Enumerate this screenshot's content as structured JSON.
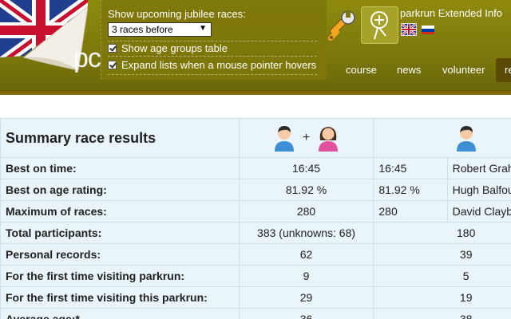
{
  "header": {
    "logo_fragment": "pc",
    "options": {
      "title": "Show upcoming jubilee races:",
      "select_value": "3 races before",
      "show_age_groups": "Show age groups table",
      "expand_lists": "Expand lists when a mouse pointer hovers"
    },
    "extension_title": "parkrun Extended Info",
    "nav": [
      "course",
      "news",
      "volunteer",
      "re"
    ]
  },
  "colors": {
    "header": "#7c780c",
    "nav_active": "#5a4a06",
    "row_alt": "#eaf4fb"
  },
  "icons": [
    "uk-flag-corner-icon",
    "wrench-icon",
    "tree-magnifier-icon",
    "uk-flag-icon",
    "russia-flag-icon",
    "male-female-icon",
    "male-icon"
  ],
  "table": {
    "title": "Summary race results",
    "rows": [
      {
        "label": "Best on time:",
        "all": "16:45",
        "val": "16:45",
        "name": "Robert Graham"
      },
      {
        "label": "Best on age rating:",
        "all": "81.92 %",
        "val": "81.92 %",
        "name": "Hugh Balfour"
      },
      {
        "label": "Maximum of races:",
        "all": "280",
        "val": "280",
        "name": "David Claybrook"
      },
      {
        "label": "Total participants:",
        "all": "383 (unknowns: 68)",
        "wide": "180"
      },
      {
        "label": "Personal records:",
        "all": "62",
        "wide": "39"
      },
      {
        "label": "For the first time visiting parkrun:",
        "all": "9",
        "wide": "5"
      },
      {
        "label": "For the first time visiting this parkrun:",
        "all": "29",
        "wide": "19"
      },
      {
        "label": "Average age:*",
        "all": "36",
        "wide": "38"
      }
    ]
  }
}
